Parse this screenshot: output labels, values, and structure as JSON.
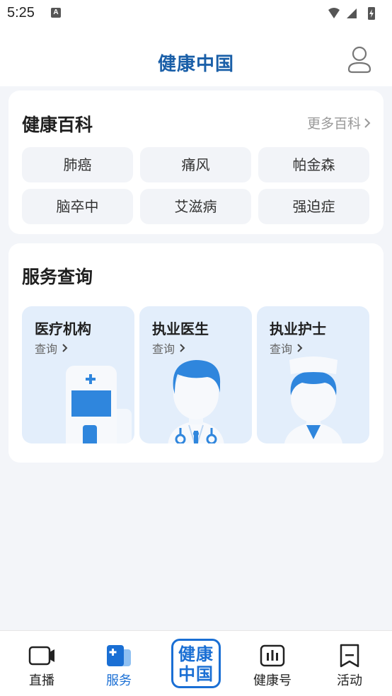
{
  "status_bar": {
    "time": "5:25",
    "notification_glyph": "A"
  },
  "header": {
    "title": "健康中国",
    "user_icon": "user-icon"
  },
  "encyclopedia": {
    "title": "健康百科",
    "more_label": "更多百科",
    "items": [
      "肺癌",
      "痛风",
      "帕金森",
      "脑卒中",
      "艾滋病",
      "强迫症"
    ]
  },
  "services": {
    "title": "服务查询",
    "items": [
      {
        "title": "医疗机构",
        "action": "查询",
        "icon": "hospital-illustration"
      },
      {
        "title": "执业医生",
        "action": "查询",
        "icon": "doctor-illustration"
      },
      {
        "title": "执业护士",
        "action": "查询",
        "icon": "nurse-illustration"
      }
    ]
  },
  "tabbar": {
    "tabs": [
      {
        "label": "直播",
        "icon": "video-camera-icon"
      },
      {
        "label": "服务",
        "icon": "service-book-icon",
        "active": true
      },
      {
        "label": "健康中国",
        "icon": "health-china-logo"
      },
      {
        "label": "健康号",
        "icon": "bar-chart-icon"
      },
      {
        "label": "活动",
        "icon": "bookmark-icon"
      }
    ],
    "center_logo_line1": "健康",
    "center_logo_line2": "中国"
  },
  "colors": {
    "brand": "#1a5fa8",
    "accent": "#1a6fd4",
    "card_bg": "#e3eefb",
    "pill_bg": "#f2f4f8"
  }
}
